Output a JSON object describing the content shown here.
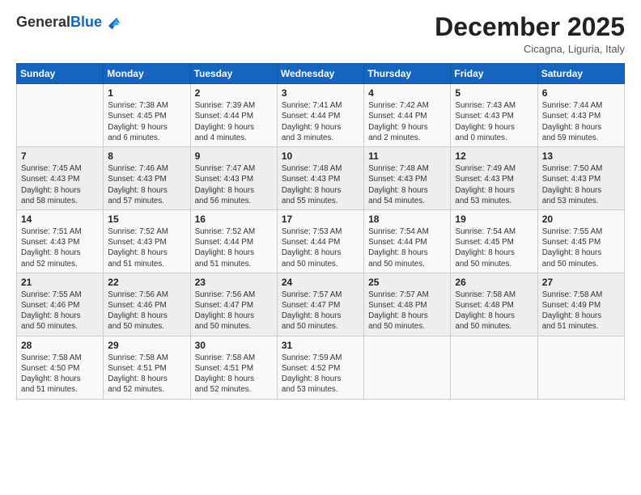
{
  "header": {
    "logo_general": "General",
    "logo_blue": "Blue",
    "month": "December 2025",
    "location": "Cicagna, Liguria, Italy"
  },
  "days_of_week": [
    "Sunday",
    "Monday",
    "Tuesday",
    "Wednesday",
    "Thursday",
    "Friday",
    "Saturday"
  ],
  "weeks": [
    [
      {
        "day": "",
        "info": ""
      },
      {
        "day": "1",
        "info": "Sunrise: 7:38 AM\nSunset: 4:45 PM\nDaylight: 9 hours\nand 6 minutes."
      },
      {
        "day": "2",
        "info": "Sunrise: 7:39 AM\nSunset: 4:44 PM\nDaylight: 9 hours\nand 4 minutes."
      },
      {
        "day": "3",
        "info": "Sunrise: 7:41 AM\nSunset: 4:44 PM\nDaylight: 9 hours\nand 3 minutes."
      },
      {
        "day": "4",
        "info": "Sunrise: 7:42 AM\nSunset: 4:44 PM\nDaylight: 9 hours\nand 2 minutes."
      },
      {
        "day": "5",
        "info": "Sunrise: 7:43 AM\nSunset: 4:43 PM\nDaylight: 9 hours\nand 0 minutes."
      },
      {
        "day": "6",
        "info": "Sunrise: 7:44 AM\nSunset: 4:43 PM\nDaylight: 8 hours\nand 59 minutes."
      }
    ],
    [
      {
        "day": "7",
        "info": "Sunrise: 7:45 AM\nSunset: 4:43 PM\nDaylight: 8 hours\nand 58 minutes."
      },
      {
        "day": "8",
        "info": "Sunrise: 7:46 AM\nSunset: 4:43 PM\nDaylight: 8 hours\nand 57 minutes."
      },
      {
        "day": "9",
        "info": "Sunrise: 7:47 AM\nSunset: 4:43 PM\nDaylight: 8 hours\nand 56 minutes."
      },
      {
        "day": "10",
        "info": "Sunrise: 7:48 AM\nSunset: 4:43 PM\nDaylight: 8 hours\nand 55 minutes."
      },
      {
        "day": "11",
        "info": "Sunrise: 7:48 AM\nSunset: 4:43 PM\nDaylight: 8 hours\nand 54 minutes."
      },
      {
        "day": "12",
        "info": "Sunrise: 7:49 AM\nSunset: 4:43 PM\nDaylight: 8 hours\nand 53 minutes."
      },
      {
        "day": "13",
        "info": "Sunrise: 7:50 AM\nSunset: 4:43 PM\nDaylight: 8 hours\nand 53 minutes."
      }
    ],
    [
      {
        "day": "14",
        "info": "Sunrise: 7:51 AM\nSunset: 4:43 PM\nDaylight: 8 hours\nand 52 minutes."
      },
      {
        "day": "15",
        "info": "Sunrise: 7:52 AM\nSunset: 4:43 PM\nDaylight: 8 hours\nand 51 minutes."
      },
      {
        "day": "16",
        "info": "Sunrise: 7:52 AM\nSunset: 4:44 PM\nDaylight: 8 hours\nand 51 minutes."
      },
      {
        "day": "17",
        "info": "Sunrise: 7:53 AM\nSunset: 4:44 PM\nDaylight: 8 hours\nand 50 minutes."
      },
      {
        "day": "18",
        "info": "Sunrise: 7:54 AM\nSunset: 4:44 PM\nDaylight: 8 hours\nand 50 minutes."
      },
      {
        "day": "19",
        "info": "Sunrise: 7:54 AM\nSunset: 4:45 PM\nDaylight: 8 hours\nand 50 minutes."
      },
      {
        "day": "20",
        "info": "Sunrise: 7:55 AM\nSunset: 4:45 PM\nDaylight: 8 hours\nand 50 minutes."
      }
    ],
    [
      {
        "day": "21",
        "info": "Sunrise: 7:55 AM\nSunset: 4:46 PM\nDaylight: 8 hours\nand 50 minutes."
      },
      {
        "day": "22",
        "info": "Sunrise: 7:56 AM\nSunset: 4:46 PM\nDaylight: 8 hours\nand 50 minutes."
      },
      {
        "day": "23",
        "info": "Sunrise: 7:56 AM\nSunset: 4:47 PM\nDaylight: 8 hours\nand 50 minutes."
      },
      {
        "day": "24",
        "info": "Sunrise: 7:57 AM\nSunset: 4:47 PM\nDaylight: 8 hours\nand 50 minutes."
      },
      {
        "day": "25",
        "info": "Sunrise: 7:57 AM\nSunset: 4:48 PM\nDaylight: 8 hours\nand 50 minutes."
      },
      {
        "day": "26",
        "info": "Sunrise: 7:58 AM\nSunset: 4:48 PM\nDaylight: 8 hours\nand 50 minutes."
      },
      {
        "day": "27",
        "info": "Sunrise: 7:58 AM\nSunset: 4:49 PM\nDaylight: 8 hours\nand 51 minutes."
      }
    ],
    [
      {
        "day": "28",
        "info": "Sunrise: 7:58 AM\nSunset: 4:50 PM\nDaylight: 8 hours\nand 51 minutes."
      },
      {
        "day": "29",
        "info": "Sunrise: 7:58 AM\nSunset: 4:51 PM\nDaylight: 8 hours\nand 52 minutes."
      },
      {
        "day": "30",
        "info": "Sunrise: 7:58 AM\nSunset: 4:51 PM\nDaylight: 8 hours\nand 52 minutes."
      },
      {
        "day": "31",
        "info": "Sunrise: 7:59 AM\nSunset: 4:52 PM\nDaylight: 8 hours\nand 53 minutes."
      },
      {
        "day": "",
        "info": ""
      },
      {
        "day": "",
        "info": ""
      },
      {
        "day": "",
        "info": ""
      }
    ]
  ]
}
